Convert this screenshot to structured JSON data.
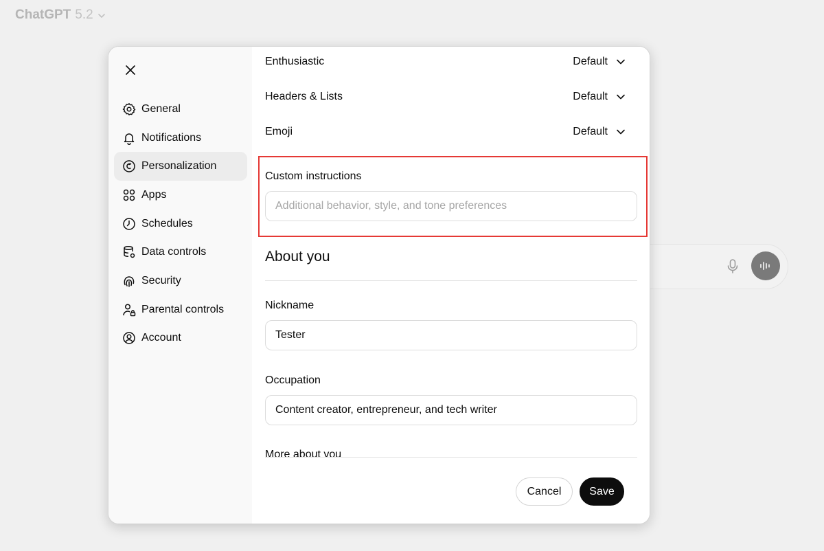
{
  "app": {
    "title": "ChatGPT",
    "version": "5.2"
  },
  "sidebar": {
    "items": [
      {
        "label": "General",
        "icon": "gear-icon"
      },
      {
        "label": "Notifications",
        "icon": "bell-icon"
      },
      {
        "label": "Personalization",
        "icon": "personalization-icon",
        "active": true
      },
      {
        "label": "Apps",
        "icon": "apps-grid-icon"
      },
      {
        "label": "Schedules",
        "icon": "clock-icon"
      },
      {
        "label": "Data controls",
        "icon": "database-gear-icon"
      },
      {
        "label": "Security",
        "icon": "fingerprint-icon"
      },
      {
        "label": "Parental controls",
        "icon": "person-lock-icon"
      },
      {
        "label": "Account",
        "icon": "user-circle-icon"
      }
    ]
  },
  "preferences": [
    {
      "label": "Enthusiastic",
      "value": "Default"
    },
    {
      "label": "Headers & Lists",
      "value": "Default"
    },
    {
      "label": "Emoji",
      "value": "Default"
    }
  ],
  "custom_instructions": {
    "label": "Custom instructions",
    "placeholder": "Additional behavior, style, and tone preferences"
  },
  "about_you": {
    "title": "About you",
    "nickname_label": "Nickname",
    "nickname_value": "Tester",
    "occupation_label": "Occupation",
    "occupation_value": "Content creator, entrepreneur, and tech writer",
    "more_label": "More about you"
  },
  "footer": {
    "cancel_label": "Cancel",
    "save_label": "Save"
  },
  "colors": {
    "highlight": "#e53935",
    "save_bg": "#0d0d0d",
    "active_nav": "#ececec"
  }
}
